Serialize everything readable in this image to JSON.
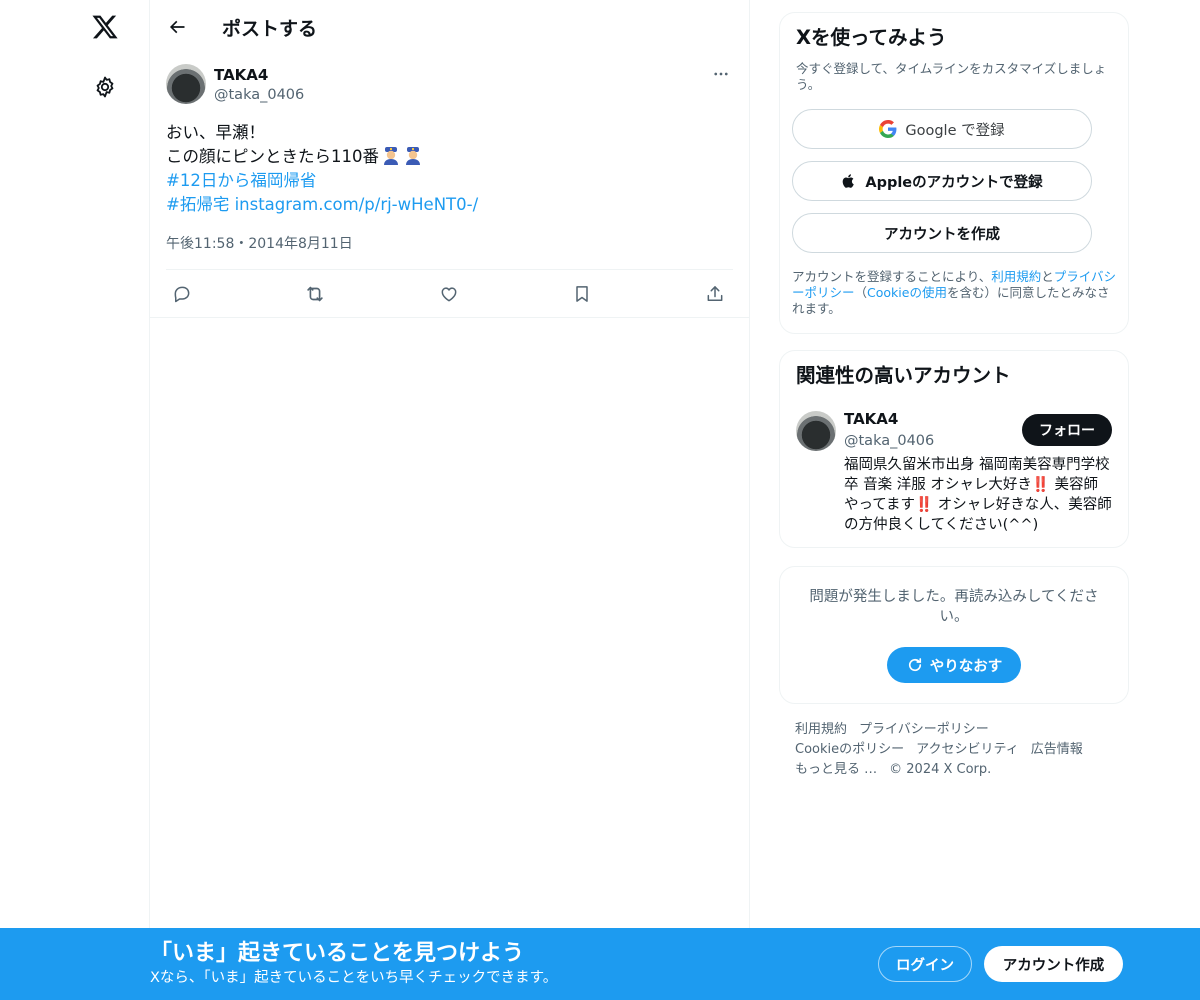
{
  "nav": {
    "logo_icon": "x-logo-icon",
    "settings_icon": "gear-icon"
  },
  "header": {
    "title": "ポストする"
  },
  "tweet": {
    "display_name": "TAKA4",
    "handle": "@taka_0406",
    "line1": "おい、早瀬！",
    "line2": "この顔にピンときたら110番",
    "line2_emoji": "police-officer-emoji",
    "hashtag1": "#12日から福岡帰省",
    "hashtag2": "#拓帰宅",
    "link": "instagram.com/p/rj-wHeNT0-/",
    "timestamp": "午後11:58・2014年8月11日"
  },
  "actions": [
    "reply-icon",
    "repost-icon",
    "like-icon",
    "bookmark-icon",
    "share-icon"
  ],
  "signup_card": {
    "title": "Xを使ってみよう",
    "subtitle": "今すぐ登録して、タイムラインをカスタマイズしましょう。",
    "google_label": "Google で登録",
    "apple_label": "Appleのアカウントで登録",
    "create_label": "アカウントを作成",
    "legal_1": "アカウントを登録することにより、",
    "legal_terms": "利用規約",
    "legal_and": "と",
    "legal_privacy": "プライバシーポリシー",
    "legal_paren_open": "（",
    "legal_cookie": "Cookieの使用",
    "legal_2": "を含む）に同意したとみなされます。"
  },
  "related": {
    "title": "関連性の高いアカウント",
    "name": "TAKA4",
    "handle": "@taka_0406",
    "follow_label": "フォロー",
    "bio": "福岡県久留米市出身 福岡南美容専門学校卒 音楽 洋服 オシャレ大好き‼️ 美容師やってます‼️ オシャレ好きな人、美容師の方仲良くしてください(^^)"
  },
  "error": {
    "message": "問題が発生しました。再読み込みしてください。",
    "retry_label": "やりなおす"
  },
  "footer": {
    "terms": "利用規約",
    "privacy": "プライバシーポリシー",
    "cookie": "Cookieのポリシー",
    "accessibility": "アクセシビリティ",
    "ads": "広告情報",
    "more": "もっと見る …",
    "copyright": "© 2024 X Corp."
  },
  "banner": {
    "title": "「いま」起きていることを見つけよう",
    "subtitle": "Xなら、「いま」起きていることをいち早くチェックできます。",
    "login_label": "ログイン",
    "signup_label": "アカウント作成"
  },
  "colors": {
    "accent": "#1d9bf0",
    "text": "#0f1419",
    "muted": "#536471",
    "border": "#eff3f4"
  }
}
